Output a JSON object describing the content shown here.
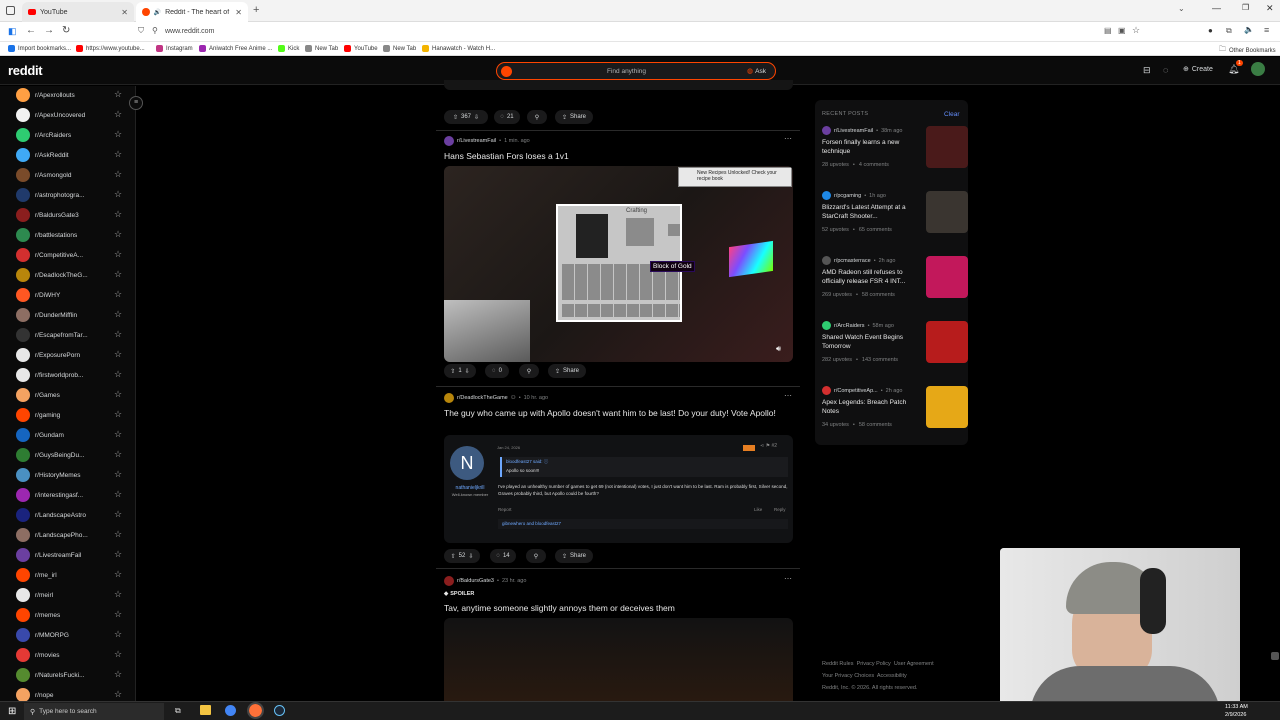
{
  "browser": {
    "tabs": [
      {
        "title": "YouTube"
      },
      {
        "title": "Reddit - The heart of the int"
      }
    ],
    "url": "www.reddit.com",
    "bookmarks": [
      "Import bookmarks...",
      "https://www.youtube...",
      "Instagram",
      "Aniwatch Free Anime ...",
      "Kick",
      "New Tab",
      "YouTube",
      "New Tab",
      "Hanawatch - Watch H..."
    ],
    "other_bookmarks": "Other Bookmarks"
  },
  "header": {
    "logo": "reddit",
    "search_placeholder": "Find anything",
    "ask_label": "Ask",
    "create_label": "Create",
    "notif_count": "1"
  },
  "sidebar": {
    "items": [
      {
        "label": "r/Apexrollouts",
        "color": "#ff9f43"
      },
      {
        "label": "r/ApexUncovered",
        "color": "#f2f2f2"
      },
      {
        "label": "r/ArcRaiders",
        "color": "#2ecc71"
      },
      {
        "label": "r/AskReddit",
        "color": "#3fa9f5"
      },
      {
        "label": "r/Asmongold",
        "color": "#7a4b2a"
      },
      {
        "label": "r/astrophotogra...",
        "color": "#203a6b"
      },
      {
        "label": "r/BaldursGate3",
        "color": "#8b1e1e"
      },
      {
        "label": "r/battlestations",
        "color": "#2d8a4f"
      },
      {
        "label": "r/CompetitiveA...",
        "color": "#d32f2f"
      },
      {
        "label": "r/DeadlockTheG...",
        "color": "#b8860b"
      },
      {
        "label": "r/DiWHY",
        "color": "#ff5722"
      },
      {
        "label": "r/DunderMifflin",
        "color": "#8d6e63"
      },
      {
        "label": "r/EscapefromTar...",
        "color": "#333333"
      },
      {
        "label": "r/ExposurePorn",
        "color": "#e8e8e8"
      },
      {
        "label": "r/firstworldprob...",
        "color": "#e8e8e8"
      },
      {
        "label": "r/Games",
        "color": "#f4a261"
      },
      {
        "label": "r/gaming",
        "color": "#ff4500"
      },
      {
        "label": "r/Gundam",
        "color": "#1565c0"
      },
      {
        "label": "r/GuysBeingDu...",
        "color": "#2e7d32"
      },
      {
        "label": "r/HistoryMemes",
        "color": "#4a90c2"
      },
      {
        "label": "r/interestingasf...",
        "color": "#9c27b0"
      },
      {
        "label": "r/LandscapeAstro",
        "color": "#1a237e"
      },
      {
        "label": "r/LandscapePho...",
        "color": "#8d6e63"
      },
      {
        "label": "r/LivestreamFail",
        "color": "#6b3fa0"
      },
      {
        "label": "r/me_irl",
        "color": "#ff4500"
      },
      {
        "label": "r/meirl",
        "color": "#e8e8e8"
      },
      {
        "label": "r/memes",
        "color": "#ff4500"
      },
      {
        "label": "r/MMORPG",
        "color": "#3949ab"
      },
      {
        "label": "r/movies",
        "color": "#e53935"
      },
      {
        "label": "r/NatureIsFucki...",
        "color": "#558b2f"
      },
      {
        "label": "r/nope",
        "color": "#f4a261"
      }
    ]
  },
  "feed": {
    "top_actions": {
      "votes": "367",
      "comments": "21",
      "share": "Share"
    },
    "posts": [
      {
        "subreddit": "r/LivestreamFail",
        "time": "1 min. ago",
        "title": "Hans Sebastian Fors loses a 1v1",
        "votes": "1",
        "comments": "0",
        "share": "Share",
        "media": {
          "crafting": "Crafting",
          "tooltip": "Block of Gold",
          "toast": "New Recipes Unlocked! Check your recipe book"
        }
      },
      {
        "subreddit": "r/DeadlockTheGame",
        "time": "10 hr. ago",
        "title": "The guy who came up with Apollo doesn't want him to be last! Do your duty! Vote Apollo!",
        "votes": "52",
        "comments": "14",
        "share": "Share",
        "forum": {
          "avatar": "N",
          "username": "nathanieljkrill",
          "rank": "Well-known member",
          "date": "Jan 24, 2026",
          "quote_author": "bloodfeast27 said: ⓘ",
          "quote": "Apollo so soon!!!",
          "body": "I've played an unhealthy number of games to get 69 (not intentional) votes, I just don't want him to be last. Ram is probably first, Silver second, Graves probably third, but Apollo could be fourth?",
          "report": "Report",
          "like": "Like",
          "reply": "Reply",
          "reactions": "gibnewhero and bloodfeast27"
        }
      },
      {
        "subreddit": "r/BaldursGate3",
        "time": "23 hr. ago",
        "tag": "SPOILER",
        "title": "Tav, anytime someone slightly annoys them or deceives them"
      }
    ]
  },
  "recent": {
    "heading": "RECENT POSTS",
    "clear": "Clear",
    "items": [
      {
        "sub": "r/LivestreamFail",
        "time": "38m ago",
        "title": "Forsen finally learns a new technique",
        "upvotes": "28 upvotes",
        "comments": "4 comments",
        "thumb": "#4a1a1a",
        "icon": "#6b3fa0"
      },
      {
        "sub": "r/pcgaming",
        "time": "1h ago",
        "title": "Blizzard's Latest Attempt at a StarCraft Shooter...",
        "upvotes": "52 upvotes",
        "comments": "65 comments",
        "thumb": "#3a3530",
        "icon": "#1e88e5"
      },
      {
        "sub": "r/pcmasterrace",
        "time": "2h ago",
        "title": "AMD Radeon still refuses to officially release FSR 4 INT...",
        "upvotes": "269 upvotes",
        "comments": "58 comments",
        "thumb": "#c2185b",
        "icon": "#555555"
      },
      {
        "sub": "r/ArcRaiders",
        "time": "58m ago",
        "title": "Shared Watch Event Begins Tomorrow",
        "upvotes": "282 upvotes",
        "comments": "143 comments",
        "thumb": "#b71c1c",
        "icon": "#2ecc71"
      },
      {
        "sub": "r/CompetitiveAp...",
        "time": "2h ago",
        "title": "Apex Legends: Breach Patch Notes",
        "upvotes": "34 upvotes",
        "comments": "58 comments",
        "thumb": "#e6a817",
        "icon": "#d32f2f"
      }
    ]
  },
  "footer": {
    "links": [
      "Reddit Rules",
      "Privacy Policy",
      "User Agreement",
      "Your Privacy Choices",
      "Accessibility"
    ],
    "copyright": "Reddit, Inc. © 2026. All rights reserved."
  },
  "taskbar": {
    "search_placeholder": "Type here to search",
    "time": "11:33 AM",
    "date": "2/9/2026"
  }
}
